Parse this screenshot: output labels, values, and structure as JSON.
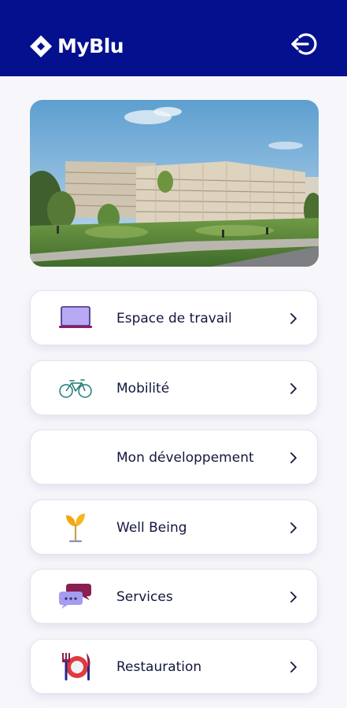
{
  "app": {
    "name": "MyBlu"
  },
  "header": {
    "logo_icon": "diamond-logo-icon",
    "logout_icon": "logout-icon"
  },
  "hero": {
    "image": "campus-building-photo"
  },
  "menu": [
    {
      "label": "Espace de travail",
      "icon": "laptop-icon"
    },
    {
      "label": "Mobilité",
      "icon": "bicycle-icon"
    },
    {
      "label": "Mon développement",
      "icon": ""
    },
    {
      "label": "Well Being",
      "icon": "sprout-icon"
    },
    {
      "label": "Services",
      "icon": "chat-bubbles-icon"
    },
    {
      "label": "Restauration",
      "icon": "cutlery-plate-icon"
    }
  ],
  "colors": {
    "header": "#04108e",
    "text": "#13173d",
    "background": "#f7f7fb",
    "card": "#ffffff"
  }
}
